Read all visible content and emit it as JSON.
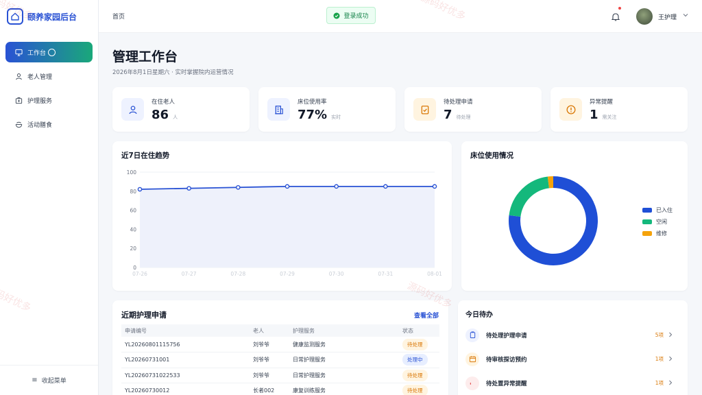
{
  "app": {
    "title": "颐养家园后台"
  },
  "sidebar": {
    "items": [
      {
        "label": "工作台",
        "icon": "monitor-icon",
        "active": true
      },
      {
        "label": "老人管理",
        "icon": "user-icon"
      },
      {
        "label": "护理服务",
        "icon": "medical-bag-icon"
      },
      {
        "label": "活动膳食",
        "icon": "food-bowl-icon"
      }
    ],
    "collapse_label": "收起菜单"
  },
  "header": {
    "breadcrumb": "首页",
    "toast": "登录成功",
    "user": "王护理"
  },
  "page": {
    "title": "管理工作台",
    "subtitle": "2026年8月1日星期六 · 实时掌握院内运营情况"
  },
  "stats": [
    {
      "label": "在住老人",
      "value": "86",
      "unit": "人",
      "icon": "user-icon",
      "color": "#2952d4",
      "bg": "#eef2ff"
    },
    {
      "label": "床位使用率",
      "value": "77%",
      "unit": "实时",
      "icon": "building-icon",
      "color": "#2952d4",
      "bg": "#eef2ff"
    },
    {
      "label": "待处理申请",
      "value": "7",
      "unit": "待处理",
      "icon": "clipboard-check-icon",
      "color": "#d97706",
      "bg": "#fff4e0"
    },
    {
      "label": "异常提醒",
      "value": "1",
      "unit": "需关注",
      "icon": "alert-circle-icon",
      "color": "#d97706",
      "bg": "#fff4e0"
    }
  ],
  "trend": {
    "title": "近7日在住趋势"
  },
  "beds": {
    "title": "床位使用情况"
  },
  "chart_data": [
    {
      "type": "area",
      "title": "近7日在住趋势",
      "categories": [
        "07-26",
        "07-27",
        "07-28",
        "07-29",
        "07-30",
        "07-31",
        "08-01"
      ],
      "values": [
        82,
        83,
        84,
        85,
        85,
        85,
        85
      ],
      "ylim": [
        0,
        100
      ],
      "yticks": [
        0,
        20,
        40,
        60,
        80,
        100
      ],
      "grid": true,
      "color": "#2952d4"
    },
    {
      "type": "pie",
      "title": "床位使用情况",
      "donut": true,
      "categories": [
        "已入住",
        "空闲",
        "维修"
      ],
      "values": [
        77,
        21,
        2
      ],
      "colors": [
        "#1f4fd6",
        "#14b87c",
        "#f5a30b"
      ],
      "legend": "right"
    }
  ],
  "requests": {
    "title": "近期护理申请",
    "view_all": "查看全部",
    "columns": [
      "申请编号",
      "老人",
      "护理服务",
      "状态"
    ],
    "rows": [
      {
        "id": "YL20260801115756",
        "elder": "刘爷爷",
        "service": "健康监测服务",
        "status": "待处理",
        "kind": "pending"
      },
      {
        "id": "YL20260731001",
        "elder": "刘爷爷",
        "service": "日常护理服务",
        "status": "处理中",
        "kind": "processing"
      },
      {
        "id": "YL20260731022533",
        "elder": "刘爷爷",
        "service": "日常护理服务",
        "status": "待处理",
        "kind": "pending"
      },
      {
        "id": "YL20260730012",
        "elder": "长者002",
        "service": "康复训练服务",
        "status": "待处理",
        "kind": "pending"
      }
    ]
  },
  "todos": {
    "title": "今日待办",
    "items": [
      {
        "label": "待处理护理申请",
        "count": "5项",
        "icon": "clipboard-icon",
        "color": "#2952d4",
        "bg": "#eef2ff"
      },
      {
        "label": "待审核探访预约",
        "count": "1项",
        "icon": "calendar-icon",
        "color": "#d97706",
        "bg": "#fff4e0"
      },
      {
        "label": "待处置异常提醒",
        "count": "1项",
        "icon": "bell-icon",
        "color": "#dc2626",
        "bg": "#fdecec"
      }
    ]
  },
  "watermark": "源码好优多"
}
